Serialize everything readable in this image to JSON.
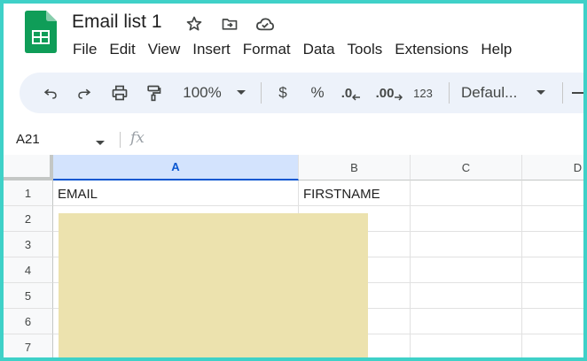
{
  "window": {
    "title": "Email list 1",
    "title_icons": [
      "star-icon",
      "move-to-folder-icon",
      "cloud-saved-icon"
    ]
  },
  "menu": {
    "items": [
      "File",
      "Edit",
      "View",
      "Insert",
      "Format",
      "Data",
      "Tools",
      "Extensions",
      "Help"
    ]
  },
  "toolbar": {
    "zoom": "100%",
    "currency": "$",
    "percent": "%",
    "decrease_decimal": ".0",
    "increase_decimal": ".00",
    "number_format": "123",
    "font": "Defaul..."
  },
  "formula_bar": {
    "cell_reference": "A21",
    "fx": "fx"
  },
  "grid": {
    "columns": [
      "A",
      "B",
      "C",
      "D"
    ],
    "selected_column": "A",
    "rows": [
      "1",
      "2",
      "3",
      "4",
      "5",
      "6",
      "7"
    ],
    "row1": {
      "a": "EMAIL",
      "b": "FIRSTNAME"
    }
  },
  "colors": {
    "frame_border": "#3fd1c8",
    "toolbar_bg": "#edf2fa",
    "selected_header": "#d3e3fd",
    "redaction": "#ece2ae",
    "sheets_green": "#0f9d58"
  }
}
